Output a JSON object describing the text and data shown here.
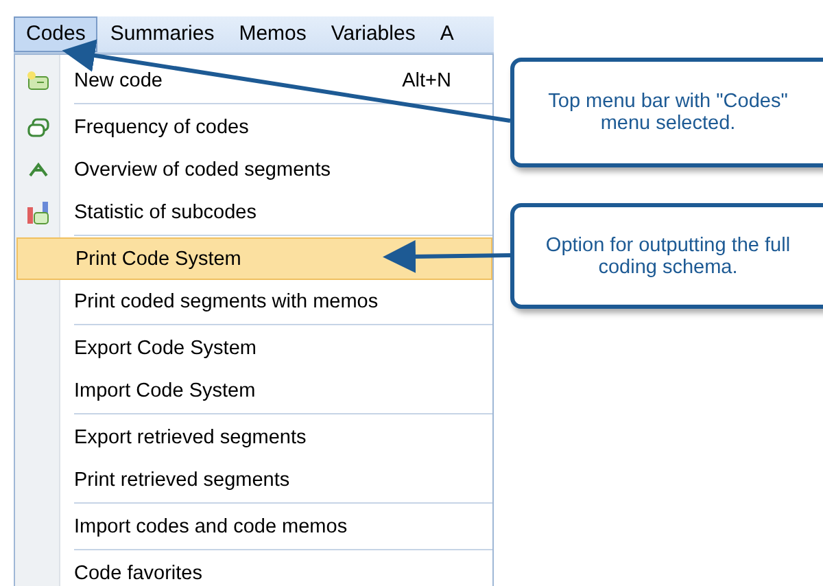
{
  "menubar": [
    {
      "label": "Codes",
      "selected": true
    },
    {
      "label": "Summaries",
      "selected": false
    },
    {
      "label": "Memos",
      "selected": false
    },
    {
      "label": "Variables",
      "selected": false
    },
    {
      "label": "A",
      "selected": false
    }
  ],
  "menu": {
    "groups": [
      [
        {
          "label": "New code",
          "shortcut": "Alt+N",
          "kind": "new",
          "selected": false
        }
      ],
      [
        {
          "label": "Frequency of codes",
          "kind": "frequency",
          "selected": false
        },
        {
          "label": "Overview of coded segments",
          "kind": "overview",
          "selected": false
        },
        {
          "label": "Statistic of subcodes",
          "kind": "statistic",
          "selected": false
        }
      ],
      [
        {
          "label": "Print Code System",
          "selected": true
        },
        {
          "label": "Print coded segments with memos",
          "selected": false
        }
      ],
      [
        {
          "label": "Export Code System",
          "selected": false
        },
        {
          "label": "Import Code System",
          "selected": false
        }
      ],
      [
        {
          "label": "Export retrieved segments",
          "selected": false
        },
        {
          "label": "Print retrieved segments",
          "selected": false
        }
      ],
      [
        {
          "label": "Import codes and code memos",
          "selected": false
        }
      ],
      [
        {
          "label": "Code favorites",
          "selected": false
        }
      ]
    ]
  },
  "callouts": [
    {
      "text": "Top menu bar with \"Codes\" menu selected."
    },
    {
      "text": "Option for outputting the full coding schema."
    }
  ]
}
